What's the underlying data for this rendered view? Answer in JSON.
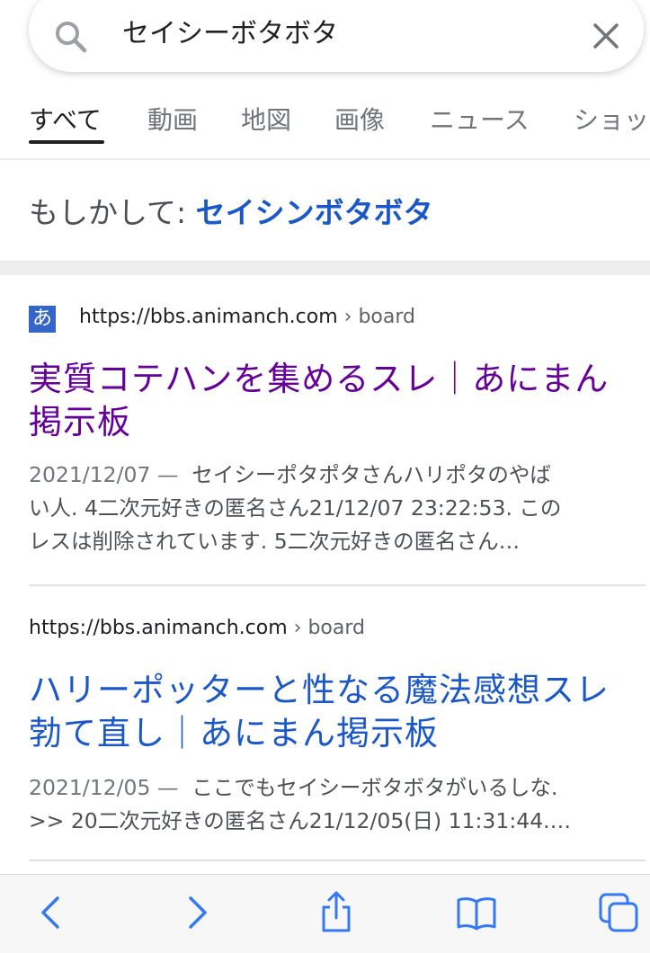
{
  "search": {
    "query": "セイシーボタボタ",
    "search_icon": "search-icon",
    "clear_icon": "close-icon"
  },
  "tabs": [
    {
      "label": "すべて",
      "active": true
    },
    {
      "label": "動画",
      "active": false
    },
    {
      "label": "地図",
      "active": false
    },
    {
      "label": "画像",
      "active": false
    },
    {
      "label": "ニュース",
      "active": false
    },
    {
      "label": "ショッ",
      "active": false
    }
  ],
  "did_you_mean": {
    "prefix": "もしかして:",
    "suggestion": "セイシンボタボタ"
  },
  "results": [
    {
      "favicon_text": "あ",
      "url": "https://bbs.animanch.com",
      "breadcrumb": "› board",
      "title_line1": "実質コテハンを集めるスレ｜あにまん",
      "title_line2": "掲示板",
      "date": "2021/12/07 —",
      "snippet_line1": "セイシーポタポタさんハリポタのやば",
      "snippet_line2": "い人. 4二次元好きの匿名さん21/12/07 23:22:53. この",
      "snippet_line3": "レスは削除されています. 5二次元好きの匿名さん…"
    },
    {
      "url": "https://bbs.animanch.com",
      "breadcrumb": "› board",
      "title_line1": "ハリーポッターと性なる魔法感想スレ",
      "title_line2": "勃て直し｜あにまん掲示板",
      "date": "2021/12/05 —",
      "snippet_line1": "ここでもセイシーボタボタがいるしな.",
      "snippet_line2": ">> 20二次元好きの匿名さん21/12/05(日) 11:31:44.…"
    }
  ],
  "toolbar": {
    "back_icon": "chevron-left-icon",
    "forward_icon": "chevron-right-icon",
    "share_icon": "share-icon",
    "bookmarks_icon": "book-icon",
    "tabs_icon": "tabs-icon"
  },
  "colors": {
    "link_visited": "#660099",
    "link_unvisited": "#1a57c8",
    "suggestion": "#1a57c8",
    "ios_blue": "#3478f6"
  }
}
